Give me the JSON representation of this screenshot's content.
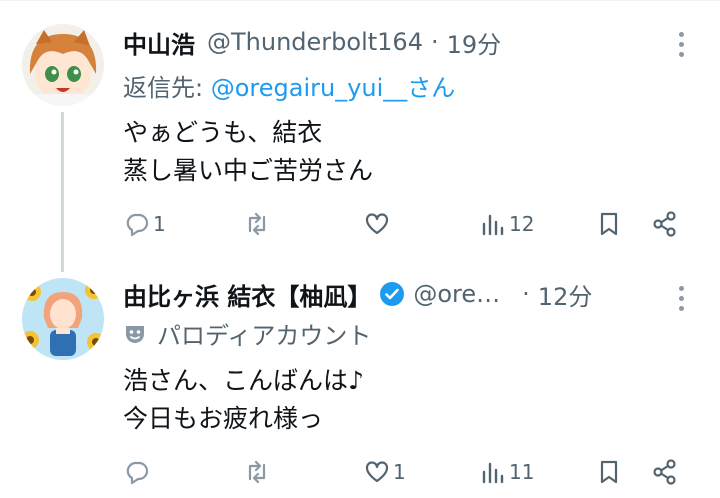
{
  "tweets": [
    {
      "name": "中山浩",
      "handle": "@Thunderbolt164",
      "separator": "·",
      "time": "19分",
      "reply_prefix": "返信先: ",
      "reply_mention": "@oregairu_yui__さん",
      "lines": [
        "やぁどうも、結衣",
        "蒸し暑い中ご苦労さん"
      ],
      "stats": {
        "replies": "1",
        "retweets": "",
        "likes": "",
        "views": "12"
      }
    },
    {
      "name": "由比ヶ浜 結衣【柚凪】",
      "handle": "@ore…",
      "separator": "·",
      "time": "12分",
      "badge": "パロディアカウント",
      "lines": [
        "浩さん、こんばんは♪",
        "今日もお疲れ様っ"
      ],
      "stats": {
        "replies": "",
        "retweets": "",
        "likes": "1",
        "views": "11"
      }
    }
  ],
  "icons": {
    "verified": "verified-badge-icon",
    "parody": "theater-mask-icon",
    "reply": "reply-bubble-icon",
    "retweet": "retweet-icon",
    "like": "heart-icon",
    "views": "views-bar-chart-icon",
    "bookmark": "bookmark-icon",
    "share": "share-icon",
    "more": "more-vertical-icon"
  },
  "colors": {
    "link": "#1d9bf0",
    "muted": "#536471",
    "thread_line": "#cfd9de",
    "verified": "#1d9bf0"
  }
}
